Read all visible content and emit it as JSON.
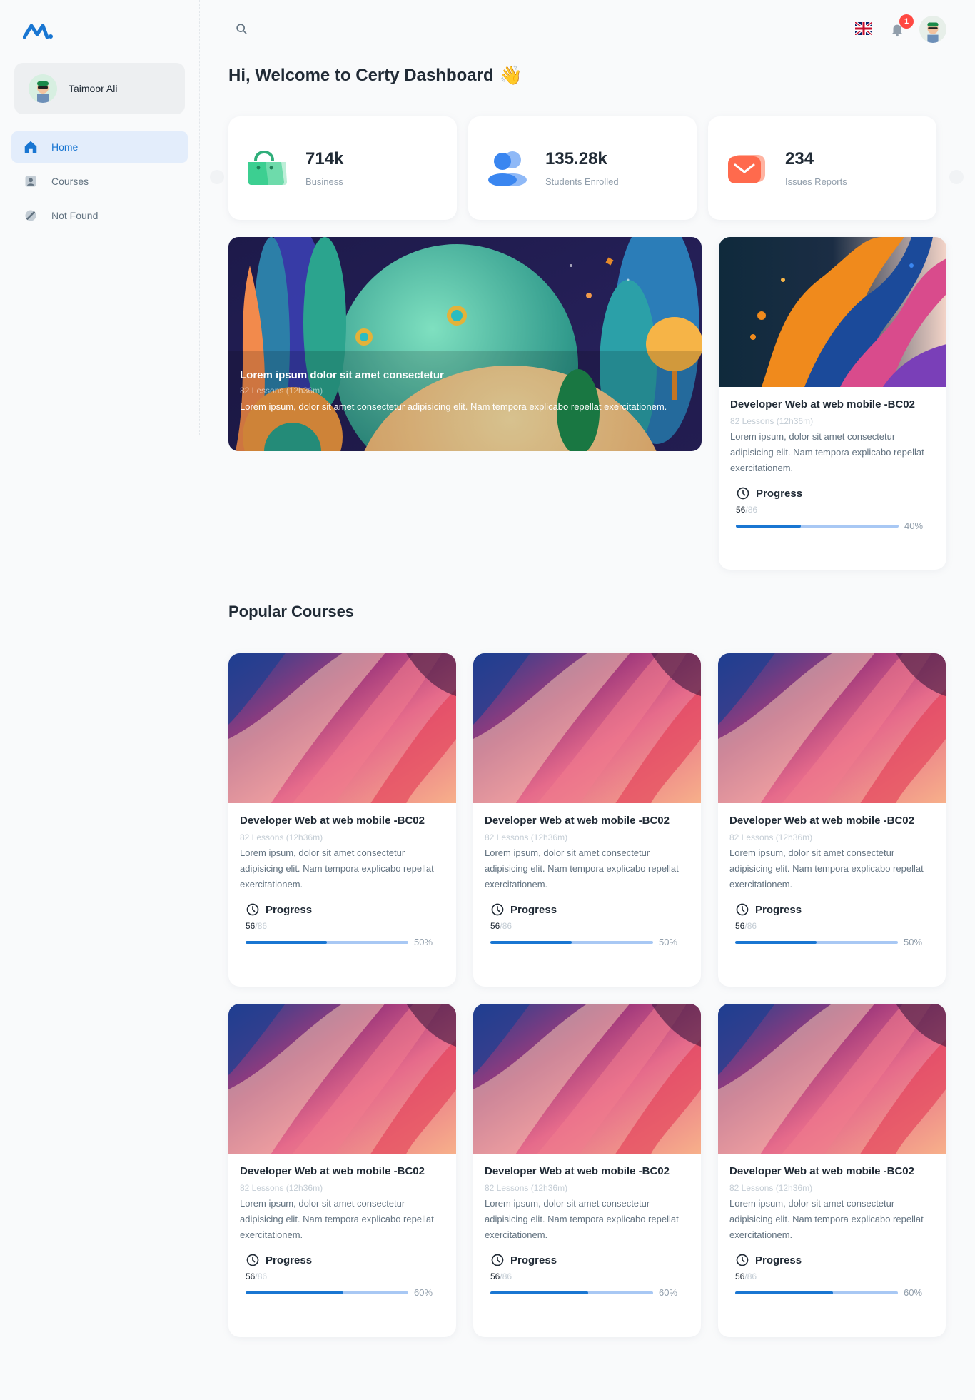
{
  "user": {
    "name": "Taimoor Ali"
  },
  "nav": [
    {
      "label": "Home",
      "icon": "home-icon",
      "active": true
    },
    {
      "label": "Courses",
      "icon": "user-card-icon",
      "active": false
    },
    {
      "label": "Not Found",
      "icon": "forbidden-icon",
      "active": false
    }
  ],
  "header": {
    "notifications": "1"
  },
  "welcome": {
    "title": "Hi, Welcome to Certy Dashboard",
    "emoji": "👋"
  },
  "stats": [
    {
      "value": "714k",
      "label": "Business",
      "icon": "shopping-bag-icon",
      "color": "#3ccf91"
    },
    {
      "value": "135.28k",
      "label": "Students Enrolled",
      "icon": "users-icon",
      "color": "#3a86f0"
    },
    {
      "value": "234",
      "label": "Issues Reports",
      "icon": "mail-icon",
      "color": "#ff6a4d"
    }
  ],
  "hero": {
    "title": "Lorem ipsum dolor sit amet consectetur",
    "lessons": "82 Lessons (12h36m)",
    "description": "Lorem ipsum, dolor sit amet consectetur adipisicing elit. Nam tempora explicabo repellat exercitationem."
  },
  "featured": {
    "title": "Developer Web at web mobile -BC02",
    "lessons": "82 Lessons (12h36m)",
    "description": "Lorem ipsum, dolor sit amet consectetur adipisicing elit. Nam tempora explicabo repellat exercitationem.",
    "progress_label": "Progress",
    "done": "56",
    "total": "/86",
    "percent": "40%",
    "fill": 0.4
  },
  "popular": {
    "title": "Popular Courses",
    "courses": [
      {
        "title": "Developer Web at web mobile -BC02",
        "lessons": "82 Lessons (12h36m)",
        "description": "Lorem ipsum, dolor sit amet consectetur adipisicing elit. Nam tempora explicabo repellat exercitationem.",
        "progress_label": "Progress",
        "done": "56",
        "total": "/86",
        "percent": "50%",
        "fill": 0.5
      },
      {
        "title": "Developer Web at web mobile -BC02",
        "lessons": "82 Lessons (12h36m)",
        "description": "Lorem ipsum, dolor sit amet consectetur adipisicing elit. Nam tempora explicabo repellat exercitationem.",
        "progress_label": "Progress",
        "done": "56",
        "total": "/86",
        "percent": "50%",
        "fill": 0.5
      },
      {
        "title": "Developer Web at web mobile -BC02",
        "lessons": "82 Lessons (12h36m)",
        "description": "Lorem ipsum, dolor sit amet consectetur adipisicing elit. Nam tempora explicabo repellat exercitationem.",
        "progress_label": "Progress",
        "done": "56",
        "total": "/86",
        "percent": "50%",
        "fill": 0.5
      },
      {
        "title": "Developer Web at web mobile -BC02",
        "lessons": "82 Lessons (12h36m)",
        "description": "Lorem ipsum, dolor sit amet consectetur adipisicing elit. Nam tempora explicabo repellat exercitationem.",
        "progress_label": "Progress",
        "done": "56",
        "total": "/86",
        "percent": "60%",
        "fill": 0.6
      },
      {
        "title": "Developer Web at web mobile -BC02",
        "lessons": "82 Lessons (12h36m)",
        "description": "Lorem ipsum, dolor sit amet consectetur adipisicing elit. Nam tempora explicabo repellat exercitationem.",
        "progress_label": "Progress",
        "done": "56",
        "total": "/86",
        "percent": "60%",
        "fill": 0.6
      },
      {
        "title": "Developer Web at web mobile -BC02",
        "lessons": "82 Lessons (12h36m)",
        "description": "Lorem ipsum, dolor sit amet consectetur adipisicing elit. Nam tempora explicabo repellat exercitationem.",
        "progress_label": "Progress",
        "done": "56",
        "total": "/86",
        "percent": "60%",
        "fill": 0.6
      }
    ]
  },
  "colors": {
    "primary": "#1976d2",
    "bar_track": "#a8c8f4",
    "badge": "#ff4842"
  }
}
